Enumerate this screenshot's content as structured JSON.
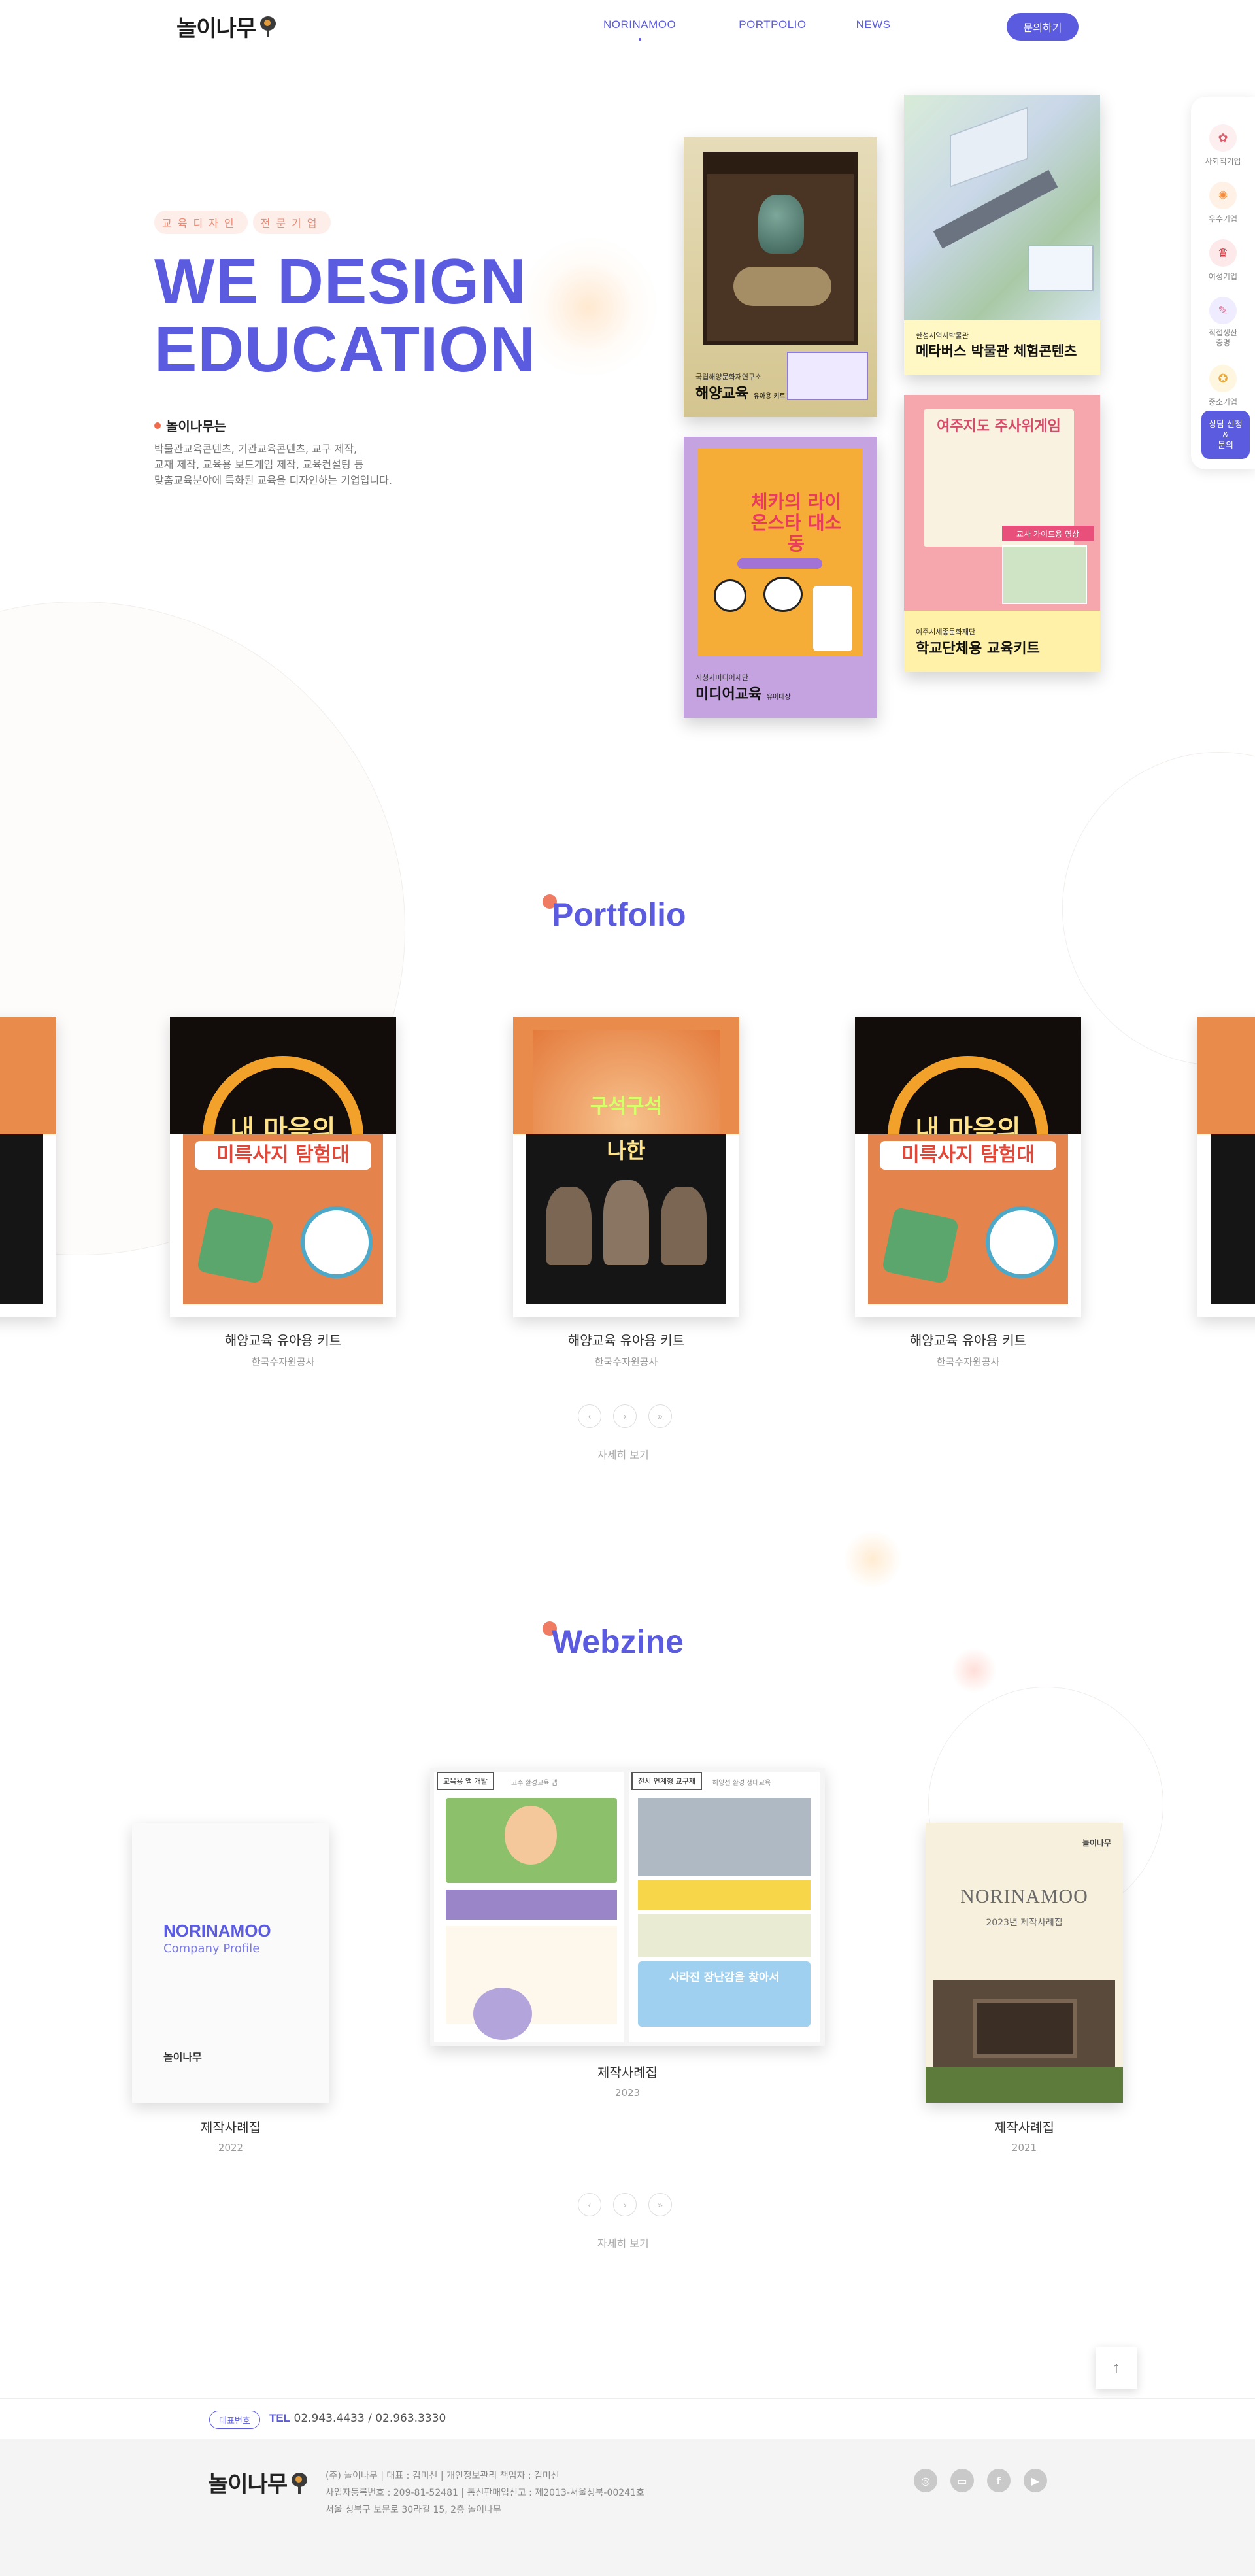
{
  "brand": {
    "logo_text": "놀이나무",
    "logo_icon": "tree-icon"
  },
  "nav": {
    "items": [
      {
        "label": "NORINAMOO",
        "active": true
      },
      {
        "label": "PORTPOLIO",
        "active": false
      },
      {
        "label": "NEWS",
        "active": false
      }
    ],
    "cta": "문의하기"
  },
  "hero": {
    "tags": [
      "교육디자인",
      "전문기업"
    ],
    "title_line1": "WE DESIGN",
    "title_line2": "EDUCATION",
    "subtitle": "놀이나무는",
    "desc": [
      "박물관교육콘텐츠, 기관교육콘텐츠, 교구 제작,",
      "교재 제작, 교육용 보드게임 제작, 교육컨설팅 등",
      "맞춤교육분야에 특화된 교육을 디자인하는 기업입니다."
    ],
    "books": [
      {
        "sub": "국립해양문화재연구소",
        "main": "해양교육",
        "tail": "유아용 키트"
      },
      {
        "sub": "한성시역사박물관",
        "main": "메타버스 박물관 체험콘텐츠",
        "tail": ""
      },
      {
        "sub": "시청자미디어재단",
        "main": "미디어교육",
        "tail": "유아대상",
        "cover_title": "체카의 라이온스타 대소동"
      },
      {
        "sub": "여주시세종문화재단",
        "main": "학교단체용 교육키트",
        "tail": "",
        "cover_title": "여주지도 주사위게임",
        "badge": "교사 가이드용 영상"
      }
    ]
  },
  "quick": {
    "items": [
      {
        "label": "사회적기업",
        "icon": "social-enterprise-icon"
      },
      {
        "label": "우수기업",
        "icon": "excellent-company-icon"
      },
      {
        "label": "여성기업",
        "icon": "women-company-icon"
      },
      {
        "label": "직접생산\n증명",
        "icon": "production-cert-icon"
      },
      {
        "label": "중소기업",
        "icon": "sme-icon"
      }
    ],
    "cta": "상담 신청\n&\n문의"
  },
  "portfolio": {
    "title": "Portfolio",
    "cards": [
      {
        "title": "해양교육 유아용 키트",
        "org": "한국수자원공사",
        "top_text": "내 마음의",
        "bottom_text": "미륵사지 탐험대"
      },
      {
        "title": "해양교육 유아용 키트",
        "org": "한국수자원공사",
        "top_text": "구석구석",
        "bottom_text": "나한"
      },
      {
        "title": "해양교육 유아용 키트",
        "org": "한국수자원공사",
        "top_text": "내 마음의",
        "bottom_text": "미륵사지 탐험대"
      }
    ],
    "more": "자세히 보기"
  },
  "webzine": {
    "title": "Webzine",
    "items": [
      {
        "title": "제작사례집",
        "year": "2022",
        "cover_brand": "NORINAMOO",
        "cover_sub": "Company Profile",
        "cover_logo": "놀이나무"
      },
      {
        "title": "제작사례집",
        "year": "2023",
        "tab_left": "교육용 앱 개발",
        "tab_right": "전시 연계형 교구재",
        "left_sub": "고수 환경교육 앱",
        "right_sub": "해양선 환경 생태교육",
        "banner": "사라진 장난감을 찾아서"
      },
      {
        "title": "제작사례집",
        "year": "2021",
        "cover_brand": "NORINAMOO",
        "cover_sub": "2023년 제작사례집",
        "cover_logo": "놀이나무"
      }
    ],
    "more": "자세히 보기"
  },
  "footer": {
    "tel_badge": "대표번호",
    "tel_label": "TEL",
    "tel_numbers": "02.943.4433 / 02.963.3330",
    "logo_text": "놀이나무",
    "info": [
      "(주) 놀이나무 | 대표 : 김미선 | 개인정보관리 책임자 : 김미선",
      "사업자등록번호 : 209-81-52481 | 통신판매업신고 : 제2013-서울성북-00241호",
      "서울 성북구 보문로 30라길 15, 2층 놀이나무"
    ],
    "social": [
      "instagram-icon",
      "blog-icon",
      "facebook-icon",
      "youtube-icon"
    ]
  },
  "colors": {
    "accent": "#5b5be0",
    "coral": "#ef7b63"
  }
}
